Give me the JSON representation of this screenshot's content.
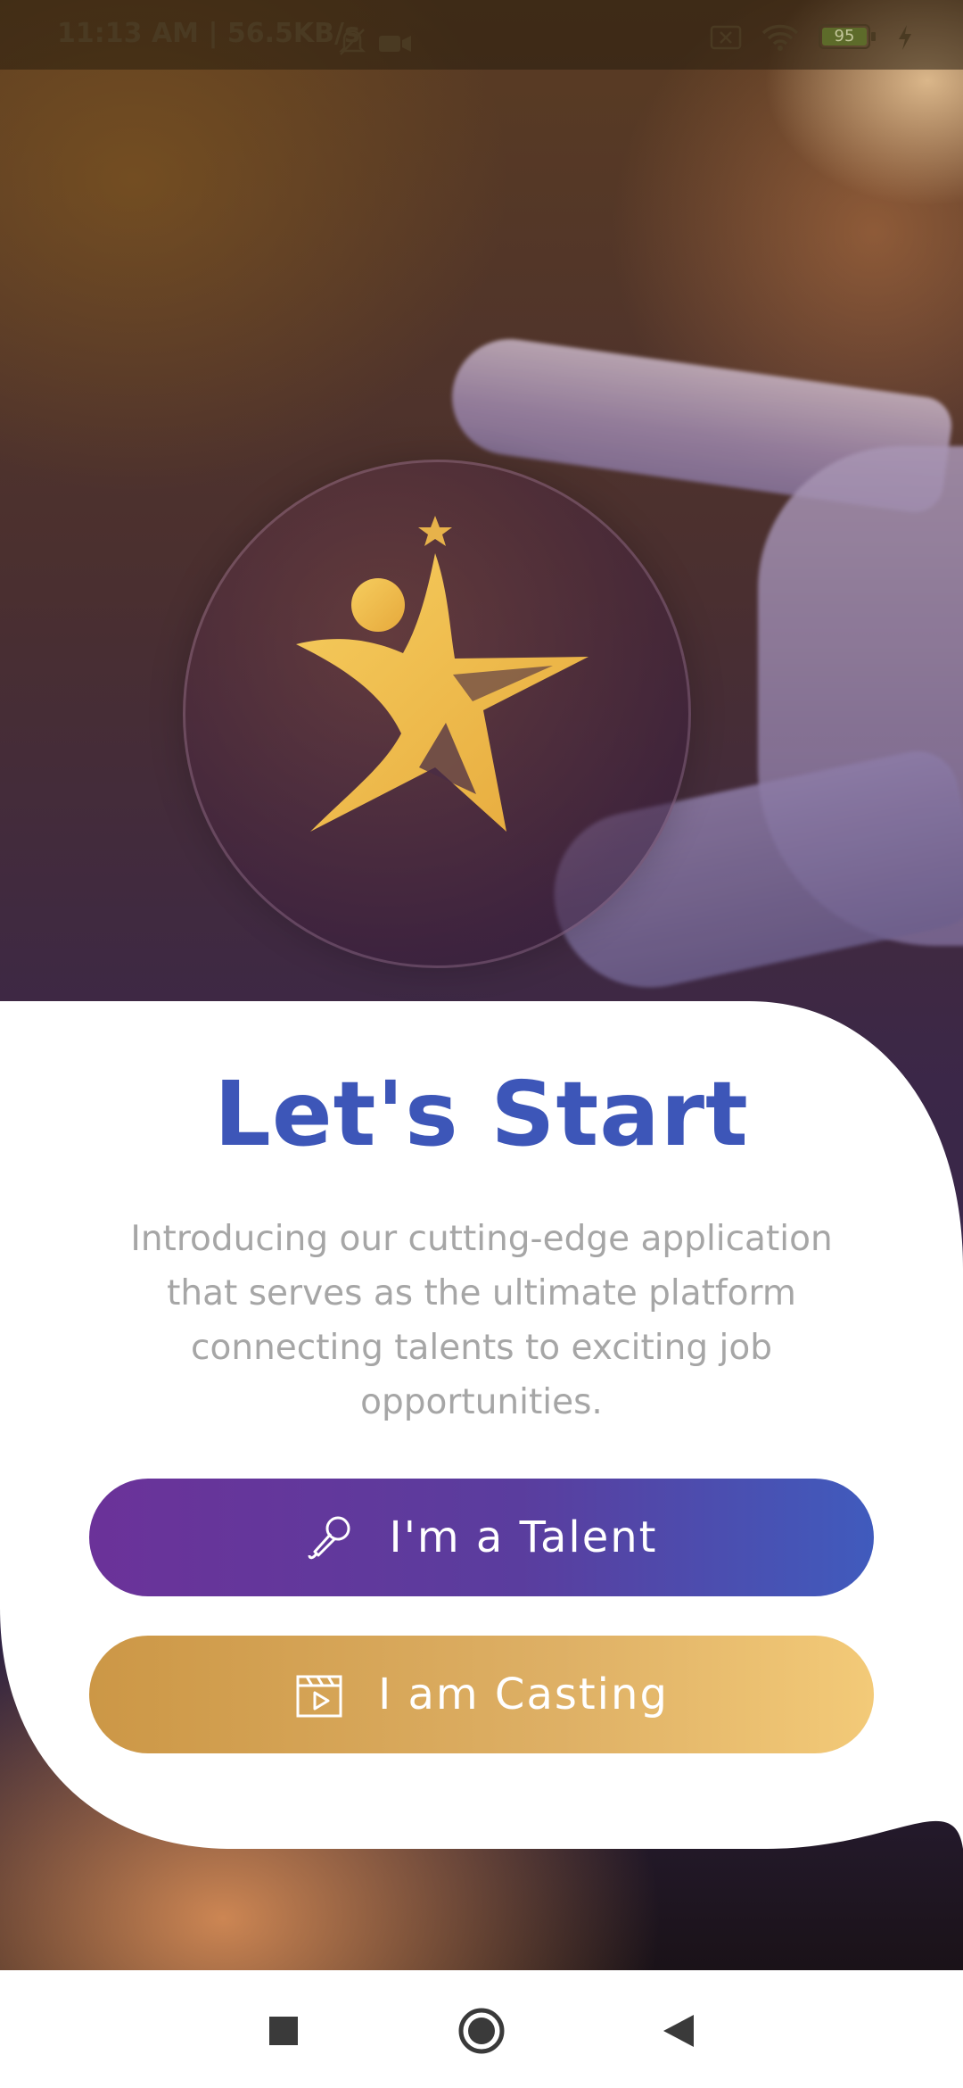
{
  "status_bar": {
    "time_text": "11:13 AM | 56.5KB/s",
    "battery_level": "95",
    "icons": [
      "mute-icon",
      "video-icon",
      "sim-x-icon",
      "wifi-icon",
      "battery-icon",
      "charging-icon"
    ]
  },
  "welcome": {
    "title": "Let's Start",
    "description": "Introducing our cutting-edge application that serves as the ultimate platform connecting talents to exciting job opportunities."
  },
  "actions": {
    "talent_label": "I'm a Talent",
    "talent_icon": "microphone-icon",
    "casting_label": "I am Casting",
    "casting_icon": "clapperboard-icon"
  },
  "colors": {
    "title": "#3d56b8",
    "talent_gradient_start": "#6b3299",
    "talent_gradient_end": "#405bbd",
    "casting_gradient_start": "#cc9746",
    "casting_gradient_end": "#f3ca78",
    "logo_gold": "#f2c14e"
  },
  "navigation": {
    "icons": [
      "recents-icon",
      "home-icon",
      "back-icon"
    ]
  }
}
